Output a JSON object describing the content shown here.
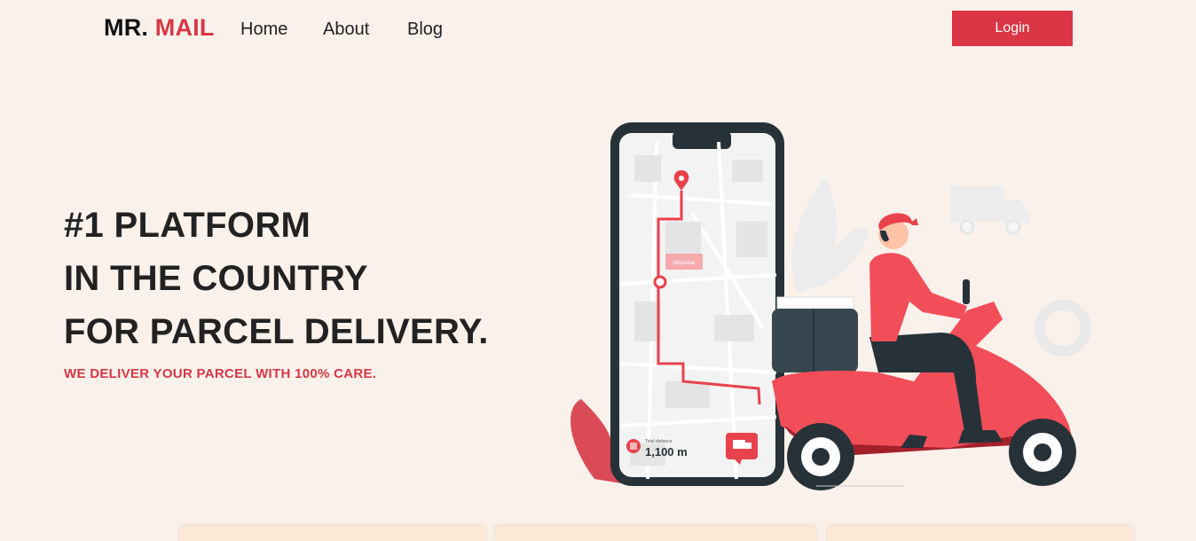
{
  "nav": {
    "brand_part1": "MR.",
    "brand_part2": "MAIL",
    "links": [
      "Home",
      "About",
      "Blog"
    ],
    "login_label": "Login"
  },
  "hero": {
    "line1": "#1 PLATFORM",
    "line2": "IN THE COUNTRY",
    "line3": "FOR PARCEL DELIVERY.",
    "subtitle": "WE DELIVER YOUR PARCEL WITH 100% CARE."
  },
  "illustration": {
    "map_label": "Objective",
    "distance_label": "Total distance",
    "distance_value": "1,100 m"
  },
  "colors": {
    "accent": "#dc3545",
    "background": "#faf1eb",
    "card": "#fbe9d6"
  }
}
